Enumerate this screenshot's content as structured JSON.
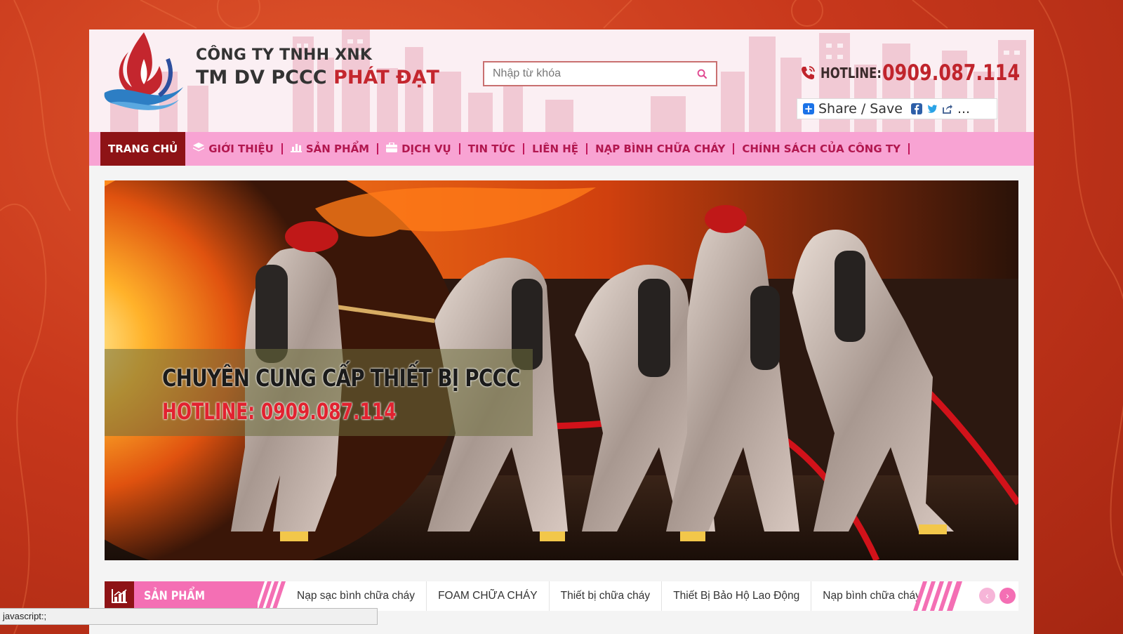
{
  "header": {
    "brand_line1": "CÔNG TY TNHH XNK",
    "brand_line2_prefix": "TM DV PCCC ",
    "brand_line2_highlight": "PHÁT ĐẠT",
    "search_placeholder": "Nhập từ khóa",
    "hotline_label": "HOTLINE:",
    "hotline_number": "0909.087.114",
    "share_label": "Share / Save",
    "share_more": "..."
  },
  "nav": {
    "items": [
      {
        "label": "TRANG CHỦ",
        "icon": "",
        "active": true
      },
      {
        "label": "GIỚI THIỆU",
        "icon": "layers-icon"
      },
      {
        "label": "SẢN PHẨM",
        "icon": "bar-chart-icon"
      },
      {
        "label": "DỊCH VỤ",
        "icon": "briefcase-icon"
      },
      {
        "label": "TIN TỨC",
        "icon": ""
      },
      {
        "label": "LIÊN HỆ",
        "icon": ""
      },
      {
        "label": "NẠP BÌNH CHỮA CHÁY",
        "icon": ""
      },
      {
        "label": "CHÍNH SÁCH CỦA CÔNG TY",
        "icon": ""
      }
    ]
  },
  "banner": {
    "title": "CHUYÊN CUNG CẤP THIẾT BỊ PCCC",
    "hotline": "HOTLINE: 0909.087.114"
  },
  "products": {
    "heading": "SẢN PHẨM",
    "tabs": [
      "Nạp sạc bình chữa cháy",
      "FOAM CHỮA CHÁY",
      "Thiết bị chữa cháy",
      "Thiết Bị Bảo Hộ Lao Động",
      "Nạp bình chữa cháy"
    ]
  },
  "status_bar": "javascript:;",
  "colors": {
    "accent": "#c0242c",
    "nav_bg": "#f8a3d3",
    "nav_active": "#8e1316",
    "pink": "#f46fb4"
  }
}
